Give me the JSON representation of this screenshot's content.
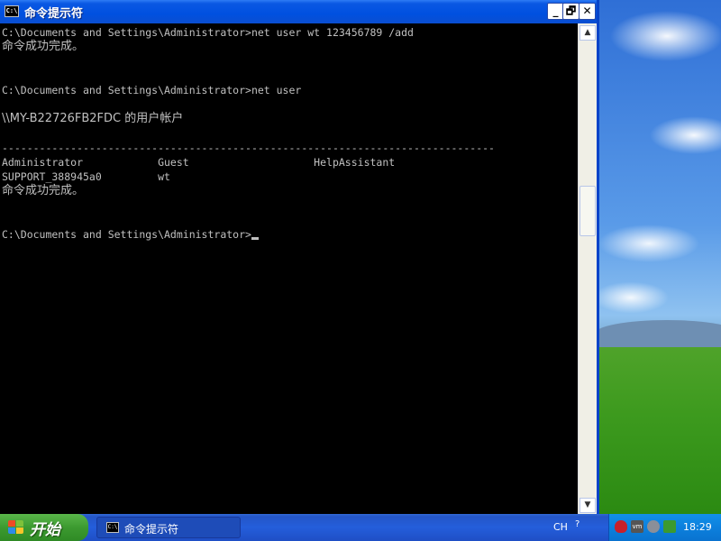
{
  "window": {
    "title": "命令提示符",
    "icon_text": "C:\\",
    "buttons": {
      "minimize": "_",
      "maximize": "🗗",
      "close": "✕"
    }
  },
  "console": {
    "lines": [
      "C:\\Documents and Settings\\Administrator>net user wt 123456789 /add",
      "命令成功完成。",
      "",
      "",
      "C:\\Documents and Settings\\Administrator>net user",
      "",
      "\\\\MY-B22726FB2FDC 的用户帐户",
      "",
      "-------------------------------------------------------------------------------",
      "Administrator            Guest                    HelpAssistant",
      "SUPPORT_388945a0         wt",
      "命令成功完成。",
      "",
      "",
      "C:\\Documents and Settings\\Administrator>"
    ]
  },
  "scrollbar": {
    "up_arrow": "▲",
    "down_arrow": "▼"
  },
  "taskbar": {
    "start_label": "开始",
    "tasks": [
      {
        "label": "命令提示符",
        "icon_text": "C:\\"
      }
    ],
    "language": "CH",
    "help_icon": "?",
    "clock": "18:29"
  }
}
